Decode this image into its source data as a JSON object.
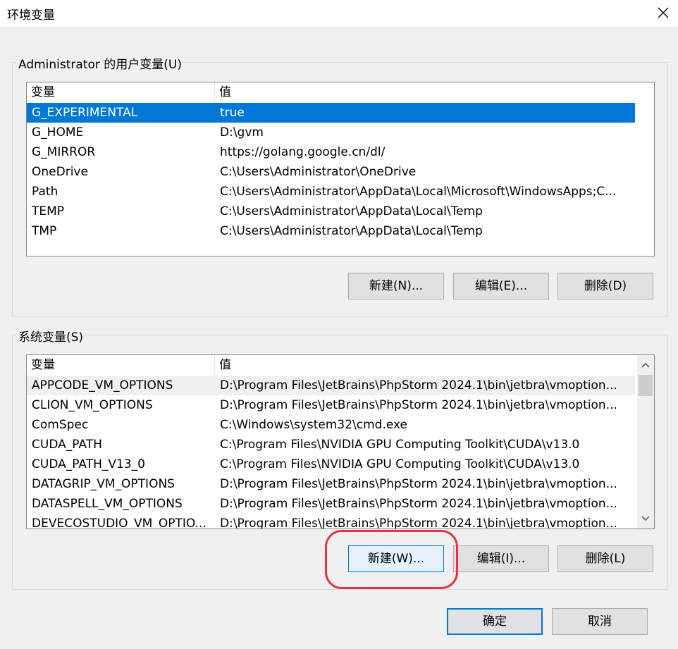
{
  "window": {
    "title": "环境变量",
    "close_icon": "close-icon"
  },
  "user_vars": {
    "group_label": "Administrator 的用户变量(U)",
    "columns": [
      "变量",
      "值"
    ],
    "rows": [
      {
        "name": "G_EXPERIMENTAL",
        "value": "true",
        "selected": true
      },
      {
        "name": "G_HOME",
        "value": "D:\\gvm"
      },
      {
        "name": "G_MIRROR",
        "value": "https://golang.google.cn/dl/"
      },
      {
        "name": "OneDrive",
        "value": "C:\\Users\\Administrator\\OneDrive"
      },
      {
        "name": "Path",
        "value": "C:\\Users\\Administrator\\AppData\\Local\\Microsoft\\WindowsApps;C..."
      },
      {
        "name": "TEMP",
        "value": "C:\\Users\\Administrator\\AppData\\Local\\Temp"
      },
      {
        "name": "TMP",
        "value": "C:\\Users\\Administrator\\AppData\\Local\\Temp"
      }
    ],
    "buttons": {
      "new": "新建(N)...",
      "edit": "编辑(E)...",
      "delete": "删除(D)"
    }
  },
  "system_vars": {
    "group_label": "系统变量(S)",
    "columns": [
      "变量",
      "值"
    ],
    "rows": [
      {
        "name": "APPCODE_VM_OPTIONS",
        "value": "D:\\Program Files\\JetBrains\\PhpStorm 2024.1\\bin\\jetbra\\vmoption...",
        "selected": true
      },
      {
        "name": "CLION_VM_OPTIONS",
        "value": "D:\\Program Files\\JetBrains\\PhpStorm 2024.1\\bin\\jetbra\\vmoption..."
      },
      {
        "name": "ComSpec",
        "value": "C:\\Windows\\system32\\cmd.exe"
      },
      {
        "name": "CUDA_PATH",
        "value": "C:\\Program Files\\NVIDIA GPU Computing Toolkit\\CUDA\\v13.0"
      },
      {
        "name": "CUDA_PATH_V13_0",
        "value": "C:\\Program Files\\NVIDIA GPU Computing Toolkit\\CUDA\\v13.0"
      },
      {
        "name": "DATAGRIP_VM_OPTIONS",
        "value": "D:\\Program Files\\JetBrains\\PhpStorm 2024.1\\bin\\jetbra\\vmoption..."
      },
      {
        "name": "DATASPELL_VM_OPTIONS",
        "value": "D:\\Program Files\\JetBrains\\PhpStorm 2024.1\\bin\\jetbra\\vmoption..."
      },
      {
        "name": "DEVECOSTUDIO_VM_OPTIO...",
        "value": "D:\\Program Files\\JetBrains\\PhpStorm 2024.1\\bin\\jetbra\\vmoption..."
      }
    ],
    "buttons": {
      "new": "新建(W)...",
      "edit": "编辑(I)...",
      "delete": "删除(L)"
    }
  },
  "footer": {
    "ok": "确定",
    "cancel": "取消"
  },
  "colors": {
    "selection": "#0078d7",
    "annotation": "#e8333f"
  }
}
